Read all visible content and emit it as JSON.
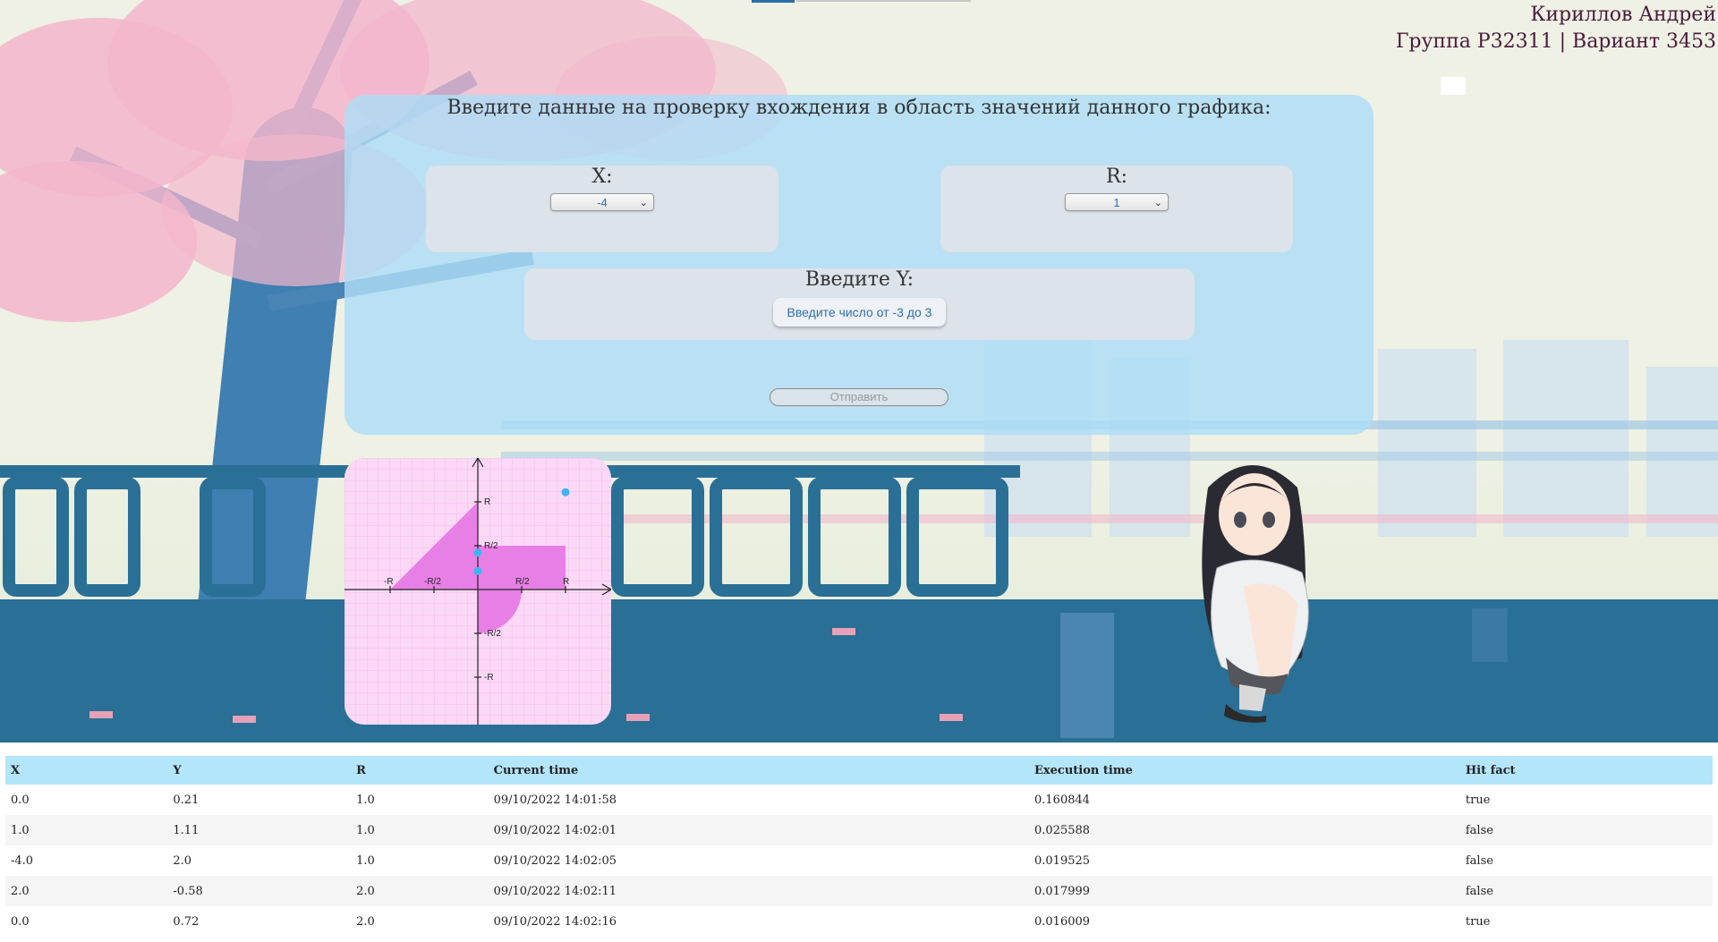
{
  "header": {
    "name": "Кириллов Андрей",
    "group_line": "Группа P32311 | Вариант 3453"
  },
  "form": {
    "title": "Введите данные на проверку вхождения в область значений данного графика:",
    "x_label": "X:",
    "x_value": "-4",
    "r_label": "R:",
    "r_value": "1",
    "y_label": "Введите Y:",
    "y_button": "Введите число от -3 до 3",
    "submit_label": "Отправить"
  },
  "graph": {
    "tick_labels": {
      "x_neg_r": "-R",
      "x_neg_half": "-R/2",
      "x_pos_half": "R/2",
      "x_pos_r": "R",
      "y_pos_r": "R",
      "y_pos_half": "R/2",
      "y_neg_half": "-R/2",
      "y_neg_r": "-R"
    },
    "colors": {
      "area": "#e87fe6",
      "point": "#3fb4f0",
      "background": "#fbd8f6"
    },
    "points_in_r_units": [
      {
        "x": 0.0,
        "y": 0.42
      },
      {
        "x": 0.0,
        "y": 0.21
      },
      {
        "x": 1.0,
        "y": 1.11
      }
    ]
  },
  "table": {
    "headers": [
      "X",
      "Y",
      "R",
      "Current time",
      "Execution time",
      "Hit fact"
    ],
    "rows": [
      [
        "0.0",
        "0.21",
        "1.0",
        "09/10/2022 14:01:58",
        "0.160844",
        "true"
      ],
      [
        "1.0",
        "1.11",
        "1.0",
        "09/10/2022 14:02:01",
        "0.025588",
        "false"
      ],
      [
        "-4.0",
        "2.0",
        "1.0",
        "09/10/2022 14:02:05",
        "0.019525",
        "false"
      ],
      [
        "2.0",
        "-0.58",
        "2.0",
        "09/10/2022 14:02:11",
        "0.017999",
        "false"
      ],
      [
        "0.0",
        "0.72",
        "2.0",
        "09/10/2022 14:02:16",
        "0.016009",
        "true"
      ]
    ]
  }
}
